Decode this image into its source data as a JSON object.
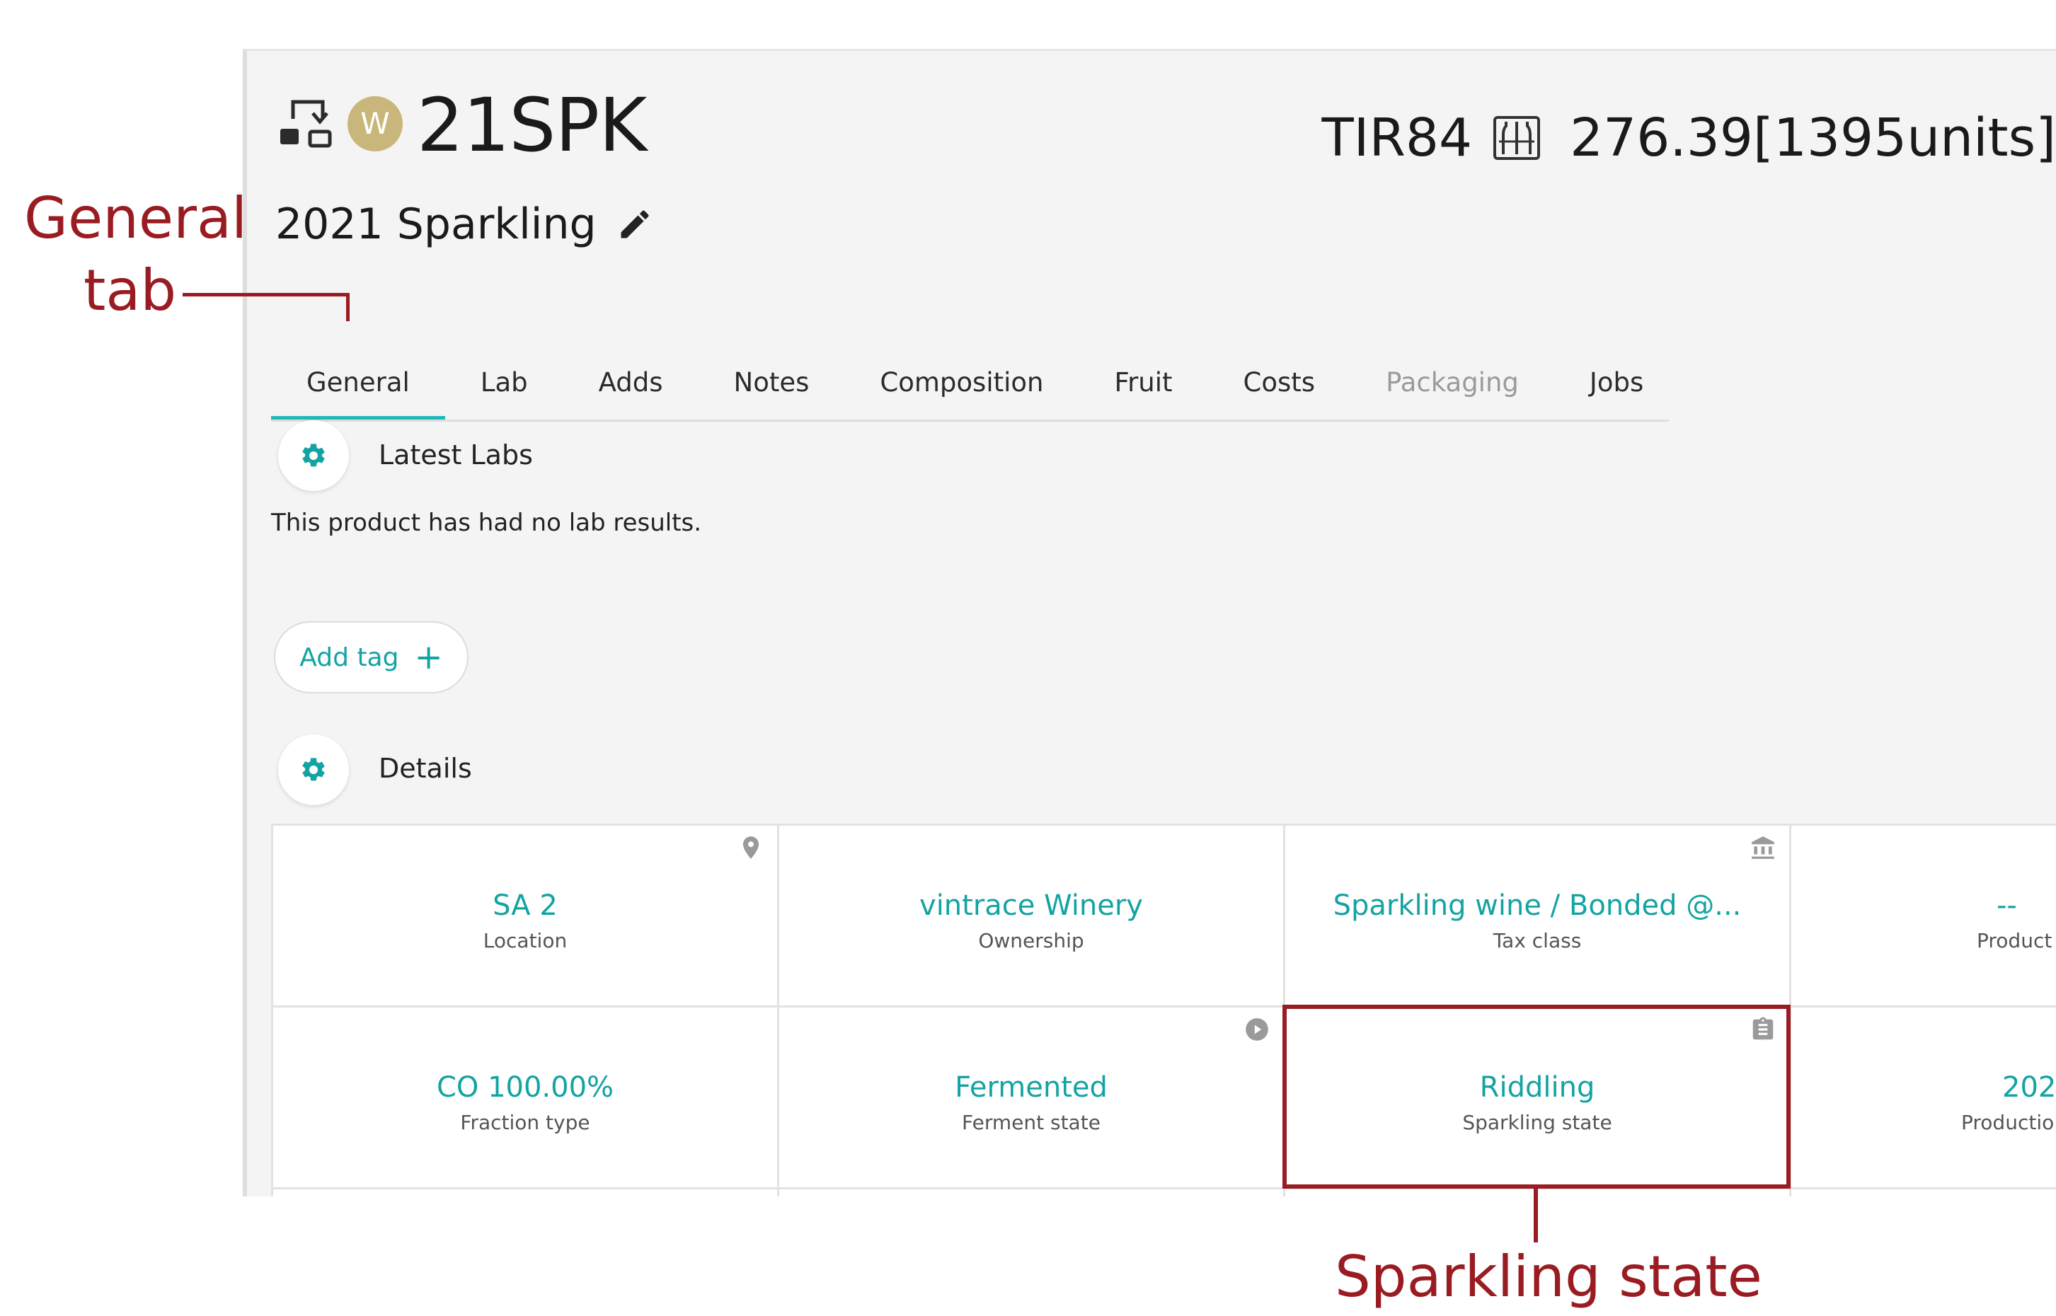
{
  "header": {
    "avatar_letter": "W",
    "product_code": "21SPK",
    "tank": "TIR84",
    "volume": "276.39[1395units]",
    "product_name": "2021 Sparkling"
  },
  "tabs": [
    {
      "label": "General",
      "state": "active"
    },
    {
      "label": "Lab",
      "state": "normal"
    },
    {
      "label": "Adds",
      "state": "normal"
    },
    {
      "label": "Notes",
      "state": "normal"
    },
    {
      "label": "Composition",
      "state": "normal"
    },
    {
      "label": "Fruit",
      "state": "normal"
    },
    {
      "label": "Costs",
      "state": "normal"
    },
    {
      "label": "Packaging",
      "state": "disabled"
    },
    {
      "label": "Jobs",
      "state": "normal"
    }
  ],
  "sections": {
    "latest_labs_title": "Latest Labs",
    "no_labs_text": "This product has had no lab results.",
    "add_tag_label": "Add tag",
    "add_tag_icon": "+",
    "details_title": "Details"
  },
  "details": [
    {
      "value": "SA 2",
      "label": "Location",
      "icon": "map-pin-icon"
    },
    {
      "value": "vintrace Winery",
      "label": "Ownership",
      "icon": ""
    },
    {
      "value": "Sparkling wine / Bonded @...",
      "label": "Tax class",
      "icon": "bank-icon"
    },
    {
      "value": "--",
      "label": "Product",
      "icon": ""
    },
    {
      "value": "CO 100.00%",
      "label": "Fraction type",
      "icon": ""
    },
    {
      "value": "Fermented",
      "label": "Ferment state",
      "icon": "play-circle-icon"
    },
    {
      "value": "Riddling",
      "label": "Sparkling state",
      "icon": "clipboard-icon"
    },
    {
      "value": "202",
      "label": "Productio",
      "icon": ""
    }
  ],
  "annotations": {
    "general_tab_line1": "General",
    "general_tab_line2": "tab",
    "sparkling_state": "Sparkling state"
  },
  "colors": {
    "accent": "#14a3a3",
    "tab_underline": "#1fb9b9",
    "annotation": "#9a1c23",
    "avatar": "#c9b67a"
  }
}
